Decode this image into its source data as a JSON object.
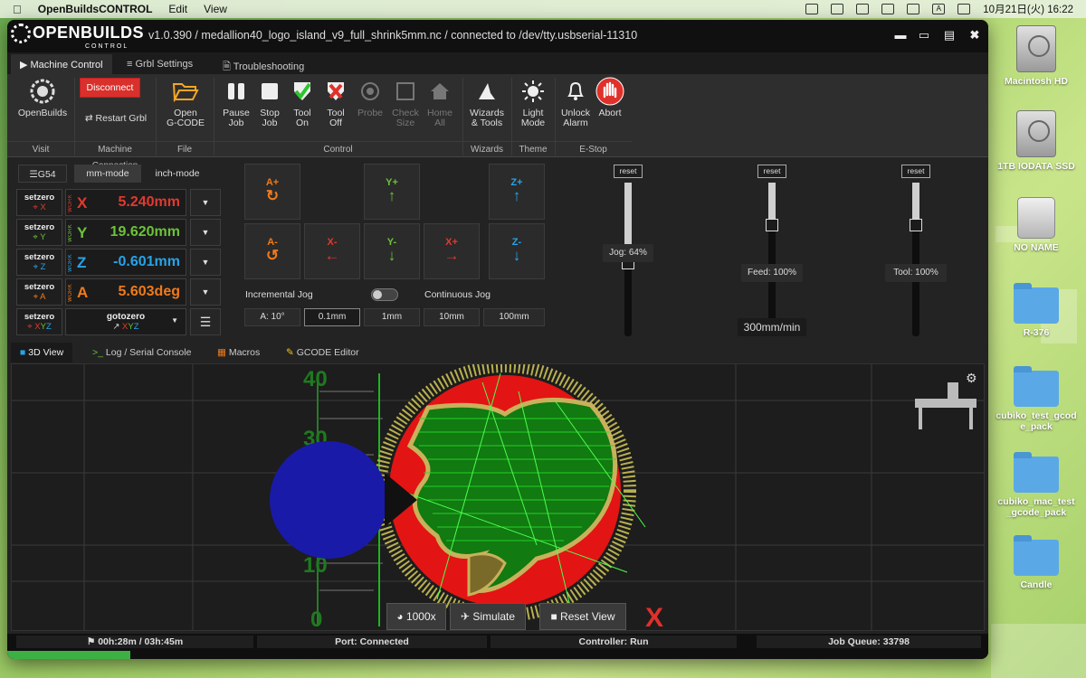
{
  "menubar": {
    "app_name": "OpenBuildsCONTROL",
    "menus": [
      "Edit",
      "View"
    ],
    "input_indicator": "A",
    "datetime": "10月21日(火)  16:22"
  },
  "desktop_icons": [
    {
      "label": "Macintosh HD",
      "kind": "hd"
    },
    {
      "label": "1TB IODATA SSD",
      "kind": "hd"
    },
    {
      "label": "NO NAME",
      "kind": "drive"
    },
    {
      "label": "R-376",
      "kind": "folder"
    },
    {
      "label": "cubiko_test_gcode_pack",
      "kind": "folder"
    },
    {
      "label": "cubiko_mac_test_gcode_pack",
      "kind": "folder"
    },
    {
      "label": "Candle",
      "kind": "folder"
    }
  ],
  "window": {
    "logo": "OPENBUILDS",
    "logo_sub": "CONTROL",
    "title": "v1.0.390 / medallion40_logo_island_v9_full_shrink5mm.nc / connected to /dev/tty.usbserial-11310"
  },
  "top_tabs": [
    "Machine Control",
    "Grbl Settings",
    "Troubleshooting"
  ],
  "ribbon": {
    "openbuilds": "OpenBuilds",
    "disconnect": "Disconnect",
    "restart": "Restart Grbl",
    "open_l1": "Open",
    "open_l2": "G-CODE",
    "pause_l1": "Pause",
    "pause_l2": "Job",
    "stop_l1": "Stop",
    "stop_l2": "Job",
    "toolon_l1": "Tool",
    "toolon_l2": "On",
    "tooloff_l1": "Tool",
    "tooloff_l2": "Off",
    "probe": "Probe",
    "check_l1": "Check",
    "check_l2": "Size",
    "home_l1": "Home",
    "home_l2": "All",
    "wiz_l1": "Wizards",
    "wiz_l2": "& Tools",
    "light_l1": "Light",
    "light_l2": "Mode",
    "unlock_l1": "Unlock",
    "unlock_l2": "Alarm",
    "abort": "Abort",
    "groups": {
      "visit": "Visit",
      "machine_connection": "Machine Connection",
      "file": "File",
      "control": "Control",
      "wizards": "Wizards",
      "theme": "Theme",
      "estop": "E-Stop"
    }
  },
  "dro": {
    "g54": "G54",
    "mm_mode": "mm-mode",
    "inch_mode": "inch-mode",
    "setzero": "setzero",
    "work": "WORK",
    "axes": [
      {
        "letter": "X",
        "value": "5.240mm",
        "color": "#e03a2f"
      },
      {
        "letter": "Y",
        "value": "19.620mm",
        "color": "#6cc23a"
      },
      {
        "letter": "Z",
        "value": "-0.601mm",
        "color": "#27a3e8"
      },
      {
        "letter": "A",
        "value": "5.603deg",
        "color": "#f07a1a"
      }
    ],
    "xyz": "XYZ",
    "gotozero": "gotozero"
  },
  "jog": {
    "a_plus": "A+",
    "a_minus": "A-",
    "x_minus": "X-",
    "x_plus": "X+",
    "y_plus": "Y+",
    "y_minus": "Y-",
    "z_plus": "Z+",
    "z_minus": "Z-",
    "incremental": "Incremental Jog",
    "continuous": "Continuous Jog",
    "steps": [
      "A: 10°",
      "0.1mm",
      "1mm",
      "10mm",
      "100mm"
    ],
    "selected_step": "0.1mm"
  },
  "sliders": [
    {
      "reset": "reset",
      "label": "Jog: 64%",
      "level": 0.64
    },
    {
      "reset": "reset",
      "label": "Feed: 100%",
      "level": 1.0,
      "value": "300mm/min"
    },
    {
      "reset": "reset",
      "label": "Tool: 100%",
      "level": 1.0
    }
  ],
  "view_tabs": [
    "3D View",
    "Log / Serial Console",
    "Macros",
    "GCODE Editor"
  ],
  "view3d": {
    "ruler_labels": [
      "40",
      "30",
      "20",
      "10",
      "0"
    ],
    "speed": "1000x",
    "simulate": "Simulate",
    "reset_view": "Reset View",
    "x_marker": "X"
  },
  "status": {
    "time": "00h:28m / 03h:45m",
    "port": "Port: Connected",
    "controller": "Controller: Run",
    "queue": "Job Queue: 33798",
    "progress": 0.125
  }
}
